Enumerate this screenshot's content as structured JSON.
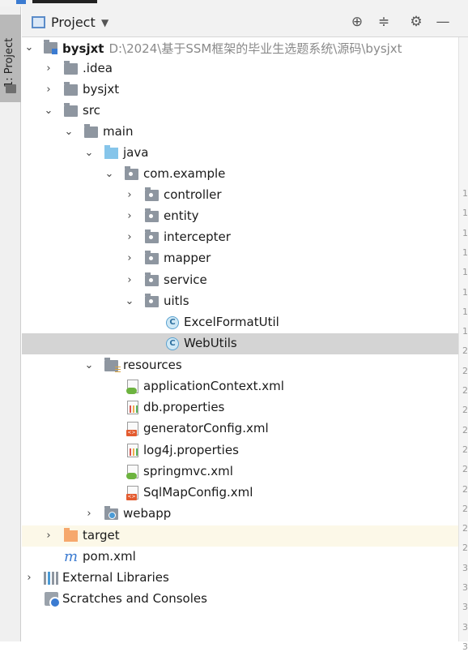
{
  "sidebar": {
    "tab_label": "1: Project"
  },
  "header": {
    "title": "Project",
    "buttons": [
      "locate-icon",
      "collapse-all-icon",
      "settings-icon",
      "hide-icon"
    ]
  },
  "tree": {
    "root": {
      "label": "bysjxt",
      "path": "D:\\2024\\基于SSM框架的毕业生选题系统\\源码\\bysjxt"
    },
    "idea": "idea",
    "bysjxt": "bysjxt",
    "src": "src",
    "main": "main",
    "java": "java",
    "com_example": "com.example",
    "controller": "controller",
    "entity": "entity",
    "intercepter": "intercepter",
    "mapper": "mapper",
    "service": "service",
    "uitls": "uitls",
    "excel": "ExcelFormatUtil",
    "webutils": "WebUtils",
    "resources": "resources",
    "appctx": "applicationContext.xml",
    "db": "db.properties",
    "genconfig": "generatorConfig.xml",
    "log4j": "log4j.properties",
    "springmvc": "springmvc.xml",
    "sqlmap": "SqlMapConfig.xml",
    "webapp": "webapp",
    "target": "target",
    "pom": "pom.xml",
    "external": "External Libraries",
    "scratches": "Scratches and Consoles"
  },
  "gutter": [
    "1",
    "1",
    "1",
    "1",
    "1",
    "1",
    "1",
    "1",
    "2",
    "2",
    "2",
    "2",
    "2",
    "2",
    "2",
    "2",
    "2",
    "2",
    "2",
    "3",
    "3",
    "3",
    "3",
    "3"
  ],
  "colors": {
    "selection": "#d4d4d4",
    "excluded": "#fcf8e8",
    "accent": "#3b7bd1"
  }
}
